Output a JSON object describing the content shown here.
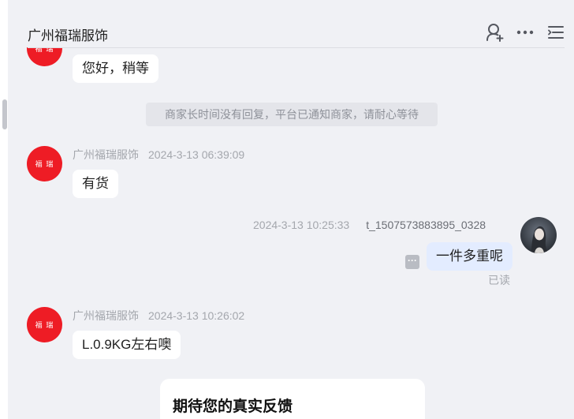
{
  "header": {
    "title": "广州福瑞服饰",
    "icons": [
      "add-user-icon",
      "more-icon",
      "list-icon"
    ]
  },
  "brand_avatar_text": "福 瑞",
  "messages": [
    {
      "bubble": "您好，稍等"
    },
    {
      "system_notice": "商家长时间没有回复，平台已通知商家，请耐心等待"
    },
    {
      "sender": "广州福瑞服饰",
      "time": "2024-3-13 06:39:09",
      "bubble": "有货"
    },
    {
      "sender": "t_1507573883895_0328",
      "time": "2024-3-13 10:25:33",
      "bubble": "一件多重呢",
      "read_status": "已读",
      "more_icon": "···"
    },
    {
      "sender": "广州福瑞服饰",
      "time": "2024-3-13 10:26:02",
      "bubble": "L.0.9KG左右噢"
    }
  ],
  "card": {
    "title": "期待您的真实反馈"
  },
  "colors": {
    "background": "#f0f1f5",
    "brand_red": "#ee1c25",
    "my_bubble": "#e3ecff",
    "meta_text": "#a4a7ad"
  }
}
